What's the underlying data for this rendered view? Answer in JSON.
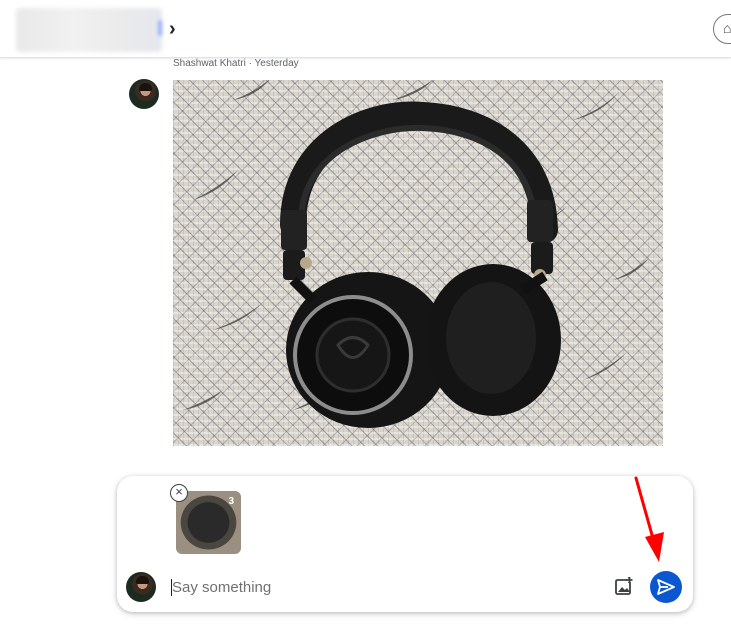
{
  "header": {
    "chat_title": "",
    "chevron_icon": "chevron-right-icon",
    "right_action_icon": "pill-button-icon"
  },
  "message": {
    "meta": "Shashwat Khatri · Yesterday",
    "sender_avatar": "user-avatar",
    "image_subject": "headphones-photo"
  },
  "compose": {
    "placeholder": "Say something",
    "value": "",
    "attachment_count": "3",
    "remove_icon": "close-circle-icon",
    "add_image_icon": "add-photo-icon",
    "send_icon": "send-icon"
  },
  "colors": {
    "accent": "#0b57d0",
    "annotation": "#ff0000"
  }
}
